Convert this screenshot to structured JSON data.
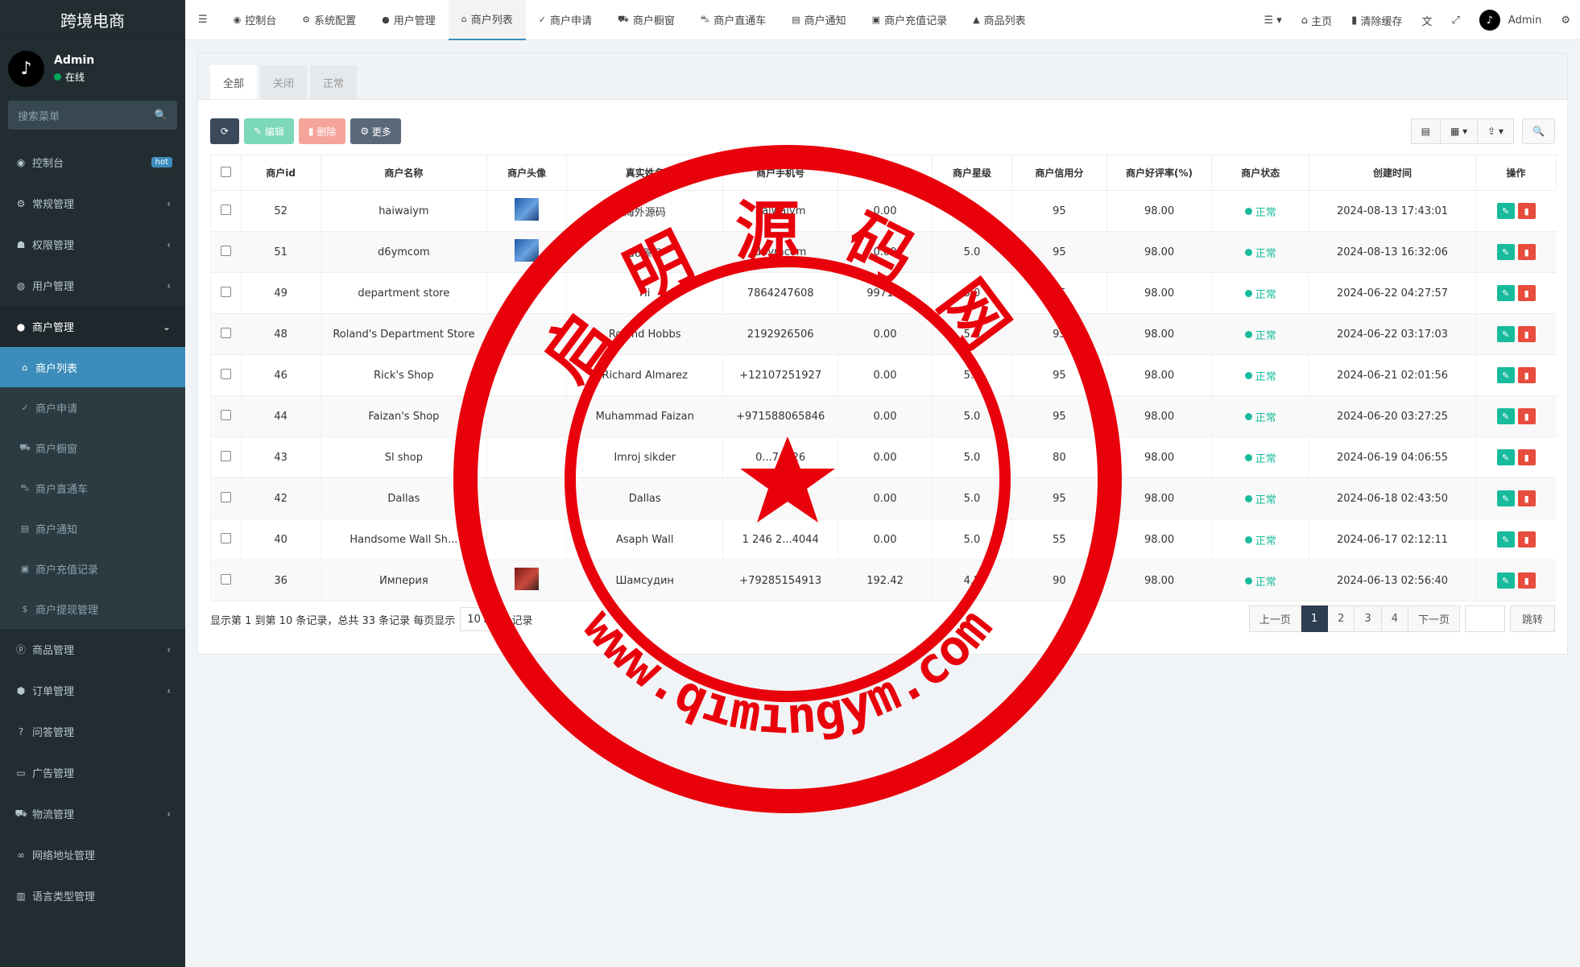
{
  "brand": "跨境电商",
  "user": {
    "name": "Admin",
    "status": "在线"
  },
  "sidebar": {
    "search_placeholder": "搜索菜单",
    "items": [
      {
        "label": "控制台",
        "icon": "dashboard-icon",
        "badge": "hot"
      },
      {
        "label": "常规管理",
        "icon": "cogs-icon"
      },
      {
        "label": "权限管理",
        "icon": "group-icon"
      },
      {
        "label": "用户管理",
        "icon": "user-circle-icon"
      },
      {
        "label": "商户管理",
        "icon": "apple-icon"
      }
    ],
    "sub_items": [
      {
        "label": "商户列表",
        "icon": "home-icon"
      },
      {
        "label": "商户申请",
        "icon": "check-circle-icon"
      },
      {
        "label": "商户橱窗",
        "icon": "cart-icon"
      },
      {
        "label": "商户直通车",
        "icon": "car-icon"
      },
      {
        "label": "商户通知",
        "icon": "note-icon"
      },
      {
        "label": "商户充值记录",
        "icon": "money-icon"
      },
      {
        "label": "商户提现管理",
        "icon": "dollar-icon"
      }
    ],
    "items_after": [
      {
        "label": "商品管理",
        "icon": "product-icon"
      },
      {
        "label": "订单管理",
        "icon": "cube-icon"
      },
      {
        "label": "问答管理",
        "icon": "question-icon"
      },
      {
        "label": "广告管理",
        "icon": "card-icon"
      },
      {
        "label": "物流管理",
        "icon": "truck-icon"
      },
      {
        "label": "网络地址管理",
        "icon": "link-icon"
      },
      {
        "label": "语言类型管理",
        "icon": "book-icon"
      }
    ]
  },
  "nav": {
    "tabs": [
      {
        "label": "控制台",
        "icon": "dashboard-icon"
      },
      {
        "label": "系统配置",
        "icon": "gear-icon"
      },
      {
        "label": "用户管理",
        "icon": "user-icon"
      },
      {
        "label": "商户列表",
        "icon": "home-icon"
      },
      {
        "label": "商户申请",
        "icon": "check-circle-icon"
      },
      {
        "label": "商户橱窗",
        "icon": "cart-icon"
      },
      {
        "label": "商户直通车",
        "icon": "car-icon"
      },
      {
        "label": "商户通知",
        "icon": "note-icon"
      },
      {
        "label": "商户充值记录",
        "icon": "money-icon"
      },
      {
        "label": "商品列表",
        "icon": "bag-icon"
      }
    ],
    "home": "主页",
    "clear_cache": "清除缓存",
    "admin": "Admin"
  },
  "panel": {
    "tabs": [
      "全部",
      "关闭",
      "正常"
    ],
    "edit": "编辑",
    "delete": "删除",
    "more": "更多"
  },
  "table": {
    "columns": [
      "商户id",
      "商户名称",
      "商户头像",
      "真实姓名",
      "商户手机号",
      "商户余额",
      "商户星级",
      "商户信用分",
      "商户好评率(%)",
      "商户状态",
      "创建时间",
      "操作"
    ],
    "rows": [
      {
        "id": "52",
        "name": "haiwaiym",
        "avatar": "blue",
        "real": "海外源码",
        "phone": "haiwaiym",
        "balance": "0.00",
        "star": "5.0",
        "credit": "95",
        "rate": "98.00",
        "status": "正常",
        "time": "2024-08-13 17:43:01"
      },
      {
        "id": "51",
        "name": "d6ymcom",
        "avatar": "blue",
        "real": "d6源码",
        "phone": "d6ymcom",
        "balance": "0.00",
        "star": "5.0",
        "credit": "95",
        "rate": "98.00",
        "status": "正常",
        "time": "2024-08-13 16:32:06"
      },
      {
        "id": "49",
        "name": "department store",
        "avatar": "",
        "real": "Hi",
        "phone": "7864247608",
        "balance": "99715.",
        "star": "5.0",
        "credit": "95",
        "rate": "98.00",
        "status": "正常",
        "time": "2024-06-22 04:27:57"
      },
      {
        "id": "48",
        "name": "Roland's Department Store",
        "avatar": "",
        "real": "Roland Hobbs",
        "phone": "2192926506",
        "balance": "0.00",
        "star": "5.0",
        "credit": "95",
        "rate": "98.00",
        "status": "正常",
        "time": "2024-06-22 03:17:03"
      },
      {
        "id": "46",
        "name": "Rick's Shop",
        "avatar": "",
        "real": "Richard Almarez",
        "phone": "+12107251927",
        "balance": "0.00",
        "star": "5.0",
        "credit": "95",
        "rate": "98.00",
        "status": "正常",
        "time": "2024-06-21 02:01:56"
      },
      {
        "id": "44",
        "name": "Faizan's Shop",
        "avatar": "",
        "real": "Muhammad Faizan",
        "phone": "+971588065846",
        "balance": "0.00",
        "star": "5.0",
        "credit": "95",
        "rate": "98.00",
        "status": "正常",
        "time": "2024-06-20 03:27:25"
      },
      {
        "id": "43",
        "name": "Sl shop",
        "avatar": "",
        "real": "Imroj sikder",
        "phone": "0...74826",
        "balance": "0.00",
        "star": "5.0",
        "credit": "80",
        "rate": "98.00",
        "status": "正常",
        "time": "2024-06-19 04:06:55"
      },
      {
        "id": "42",
        "name": "Dallas",
        "avatar": "",
        "real": "Dallas",
        "phone": "...05",
        "balance": "0.00",
        "star": "5.0",
        "credit": "95",
        "rate": "98.00",
        "status": "正常",
        "time": "2024-06-18 02:43:50"
      },
      {
        "id": "40",
        "name": "Handsome Wall Sh...",
        "avatar": "",
        "real": "Asaph Wall",
        "phone": "1 246 2...4044",
        "balance": "0.00",
        "star": "5.0",
        "credit": "55",
        "rate": "98.00",
        "status": "正常",
        "time": "2024-06-17 02:12:11"
      },
      {
        "id": "36",
        "name": "Империя",
        "avatar": "red",
        "real": "Шамсудин",
        "phone": "+79285154913",
        "balance": "192.42",
        "star": "4.5",
        "credit": "90",
        "rate": "98.00",
        "status": "正常",
        "time": "2024-06-13 02:56:40"
      }
    ]
  },
  "footer": {
    "info_prefix": "显示第 1 到第 10 条记录，总共 33 条记录 每页显示",
    "page_size": "10",
    "info_suffix": "条记录",
    "prev": "上一页",
    "pages": [
      "1",
      "2",
      "3",
      "4"
    ],
    "next": "下一页",
    "jump": "跳转"
  },
  "watermark": {
    "top_text": "启明源码网",
    "bottom_text": "www.qimingym.com",
    "color": "#e8000b"
  }
}
